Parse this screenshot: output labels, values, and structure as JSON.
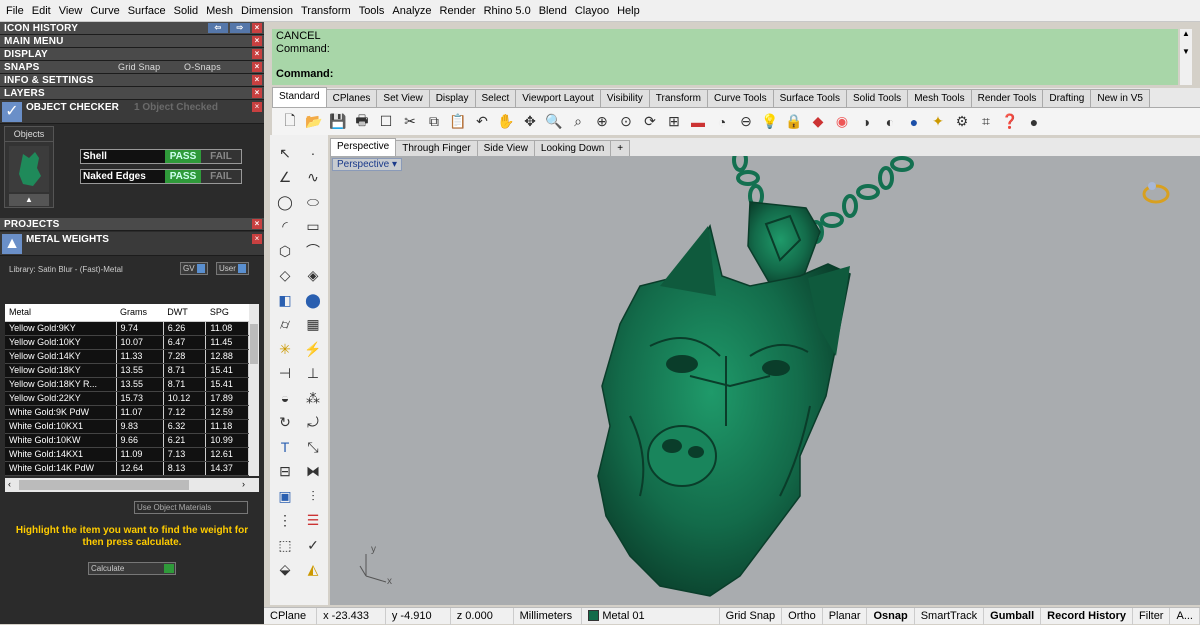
{
  "menu": [
    "File",
    "Edit",
    "View",
    "Curve",
    "Surface",
    "Solid",
    "Mesh",
    "Dimension",
    "Transform",
    "Tools",
    "Analyze",
    "Render",
    "Rhino 5.0",
    "Blend",
    "Clayoo",
    "Help"
  ],
  "panels": {
    "icon_history": "ICON HISTORY",
    "main_menu": "MAIN MENU",
    "display": "DISPLAY",
    "snaps": "SNAPS",
    "grid_snap": "Grid Snap",
    "o_snaps": "O-Snaps",
    "info_settings": "INFO & SETTINGS",
    "layers": "LAYERS",
    "object_checker": "OBJECT CHECKER",
    "checked_count": "1 Object Checked",
    "objects": "Objects",
    "checks": [
      {
        "name": "Shell",
        "pass": "PASS",
        "fail": "FAIL"
      },
      {
        "name": "Naked Edges",
        "pass": "PASS",
        "fail": "FAIL"
      }
    ],
    "projects": "PROJECTS",
    "metal_weights": "METAL WEIGHTS",
    "library": "Library: Satin Blur - (Fast)-Metal",
    "gv": "GV",
    "user": "User",
    "use_object_materials": "Use Object Materials",
    "hint": "Highlight the item you want to find the weight for then press calculate.",
    "calculate": "Calculate"
  },
  "metal_table": {
    "columns": [
      "Metal",
      "Grams",
      "DWT",
      "SPG"
    ],
    "rows": [
      [
        "Yellow Gold:9KY",
        "9.74",
        "6.26",
        "11.08"
      ],
      [
        "Yellow Gold:10KY",
        "10.07",
        "6.47",
        "11.45"
      ],
      [
        "Yellow Gold:14KY",
        "11.33",
        "7.28",
        "12.88"
      ],
      [
        "Yellow Gold:18KY",
        "13.55",
        "8.71",
        "15.41"
      ],
      [
        "Yellow Gold:18KY R...",
        "13.55",
        "8.71",
        "15.41"
      ],
      [
        "Yellow Gold:22KY",
        "15.73",
        "10.12",
        "17.89"
      ],
      [
        "White Gold:9K PdW",
        "11.07",
        "7.12",
        "12.59"
      ],
      [
        "White Gold:10KX1",
        "9.83",
        "6.32",
        "11.18"
      ],
      [
        "White Gold:10KW",
        "9.66",
        "6.21",
        "10.99"
      ],
      [
        "White Gold:14KX1",
        "11.09",
        "7.13",
        "12.61"
      ],
      [
        "White Gold:14K PdW",
        "12.64",
        "8.13",
        "14.37"
      ]
    ]
  },
  "command": {
    "line1": "CANCEL",
    "line2": "Command:",
    "prompt": "Command:"
  },
  "toolbar_tabs": [
    "Standard",
    "CPlanes",
    "Set View",
    "Display",
    "Select",
    "Viewport Layout",
    "Visibility",
    "Transform",
    "Curve Tools",
    "Surface Tools",
    "Solid Tools",
    "Mesh Tools",
    "Render Tools",
    "Drafting",
    "New in V5"
  ],
  "viewport_tabs": [
    "Perspective",
    "Through Finger",
    "Side View",
    "Looking Down"
  ],
  "viewport_label": "Perspective",
  "axes": {
    "x": "x",
    "y": "y"
  },
  "status": {
    "cplane": "CPlane",
    "x": "x -23.433",
    "y": "y -4.910",
    "z": "z 0.000",
    "units": "Millimeters",
    "layer": "Metal 01",
    "grid_snap": "Grid Snap",
    "ortho": "Ortho",
    "planar": "Planar",
    "osnap": "Osnap",
    "smarttrack": "SmartTrack",
    "gumball": "Gumball",
    "record_history": "Record History",
    "filter": "Filter",
    "more": "A..."
  },
  "colors": {
    "model": "#136b4a",
    "command_bg": "#a8d6a8",
    "viewport_bg": "#a9acaf"
  }
}
